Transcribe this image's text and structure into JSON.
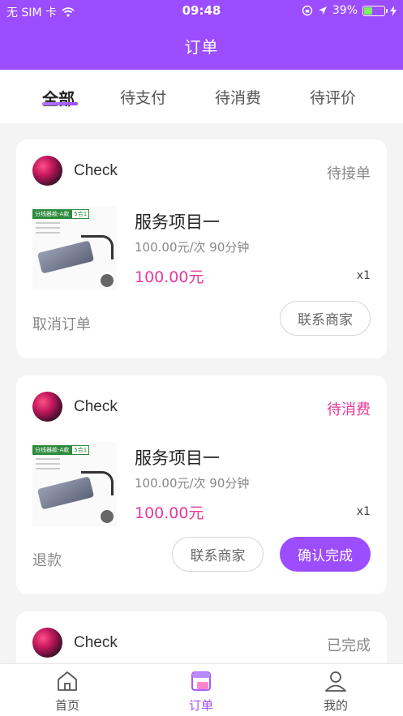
{
  "status_bar": {
    "carrier": "无 SIM 卡",
    "time": "09:48",
    "battery": "39%"
  },
  "nav": {
    "title": "订单"
  },
  "tabs": [
    {
      "label": "全部",
      "active": true
    },
    {
      "label": "待支付",
      "active": false
    },
    {
      "label": "待消费",
      "active": false
    },
    {
      "label": "待评价",
      "active": false
    }
  ],
  "orders": [
    {
      "shop": "Check",
      "status": "待接单",
      "product_name": "服务项目一",
      "product_meta": "100.00元/次  90分钟",
      "price": "100.00元",
      "qty": "x1",
      "left_action": "取消订单",
      "buttons": [
        "联系商家"
      ]
    },
    {
      "shop": "Check",
      "status": "待消费",
      "product_name": "服务项目一",
      "product_meta": "100.00元/次  90分钟",
      "price": "100.00元",
      "qty": "x1",
      "left_action": "退款",
      "buttons": [
        "联系商家",
        "确认完成"
      ]
    },
    {
      "shop": "Check",
      "status": "已完成"
    }
  ],
  "thumb": {
    "badge_main": "分线器款-A款",
    "badge_sub": "5合1",
    "badge_dot": "深空灰"
  },
  "bottom_nav": [
    {
      "label": "首页",
      "icon": "home-icon",
      "active": false
    },
    {
      "label": "订单",
      "icon": "orders-icon",
      "active": true
    },
    {
      "label": "我的",
      "icon": "profile-icon",
      "active": false
    }
  ],
  "colors": {
    "accent": "#9b4dff",
    "price": "#e6399b"
  }
}
